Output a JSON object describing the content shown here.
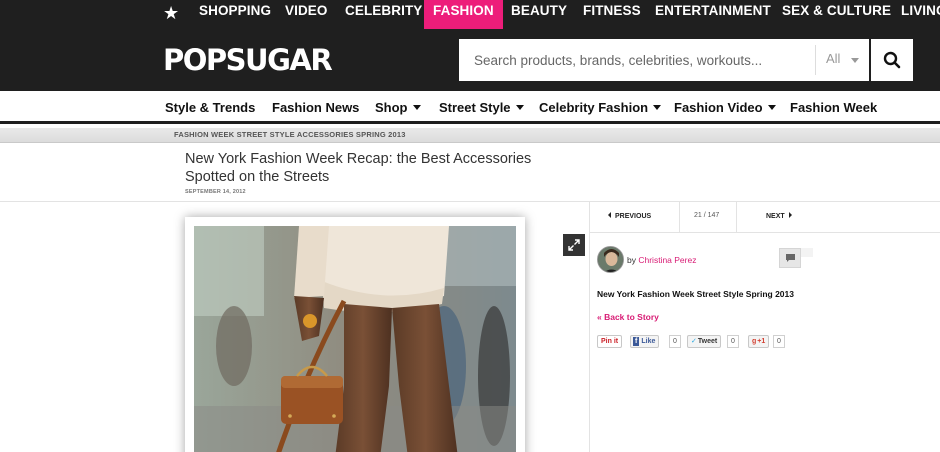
{
  "topnav": {
    "items": [
      "SHOPPING",
      "VIDEO",
      "CELEBRITY",
      "FASHION",
      "BEAUTY",
      "FITNESS",
      "ENTERTAINMENT",
      "SEX & CULTURE",
      "LIVING"
    ],
    "active": "FASHION",
    "active_color": "#ed1d7a"
  },
  "header": {
    "logo": "POPSUGAR",
    "search": {
      "placeholder": "Search products, brands, celebrities, workouts...",
      "scope": "All"
    }
  },
  "subnav": {
    "items": [
      "Style & Trends",
      "Fashion News",
      "Shop",
      "Street Style",
      "Celebrity Fashion",
      "Fashion Video",
      "Fashion Week"
    ]
  },
  "breadcrumb": "FASHION WEEK STREET STYLE ACCESSORIES SPRING 2013",
  "article": {
    "title": "New York Fashion Week Recap: the Best Accessories Spotted on the Streets",
    "date": "SEPTEMBER 14, 2012"
  },
  "pager": {
    "previous": "PREVIOUS",
    "count": "21 / 147",
    "next": "NEXT"
  },
  "author": {
    "by": "by",
    "name": "Christina Perez"
  },
  "gallery_title": "New York Fashion Week Street Style Spring 2013",
  "back_link": "« Back to Story",
  "share": {
    "pinit": "Pin it",
    "like": "Like",
    "like_count": "0",
    "tweet": "Tweet",
    "tweet_count": "0",
    "plus": "+1",
    "plus_count": "0"
  },
  "colors": {
    "brand_pink": "#d81b74",
    "dark": "#1f1f1f"
  }
}
